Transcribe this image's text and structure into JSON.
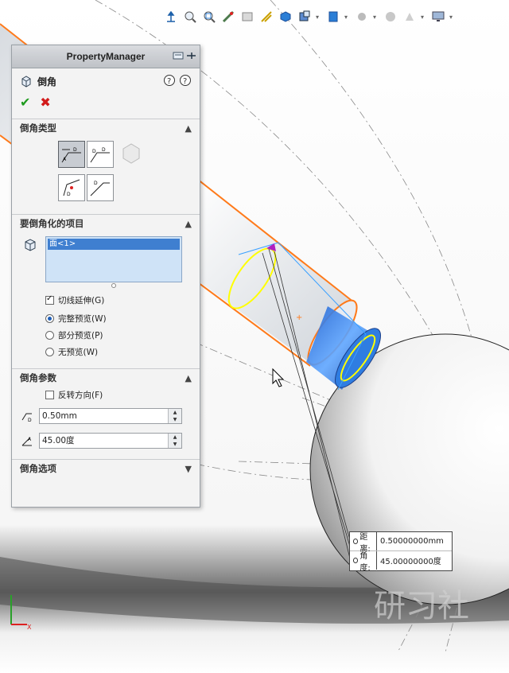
{
  "property_manager": {
    "title": "PropertyManager",
    "feature_name": "倒角",
    "sections": {
      "chamfer_type": {
        "title": "倒角类型"
      },
      "items": {
        "title": "要倒角化的项目",
        "list": [
          "面<1>"
        ],
        "options": {
          "tangent_propagation": {
            "label": "切线延伸(G)",
            "checked": true
          },
          "preview_radios": [
            {
              "label": "完整预览(W)",
              "checked": true
            },
            {
              "label": "部分预览(P)",
              "checked": false
            },
            {
              "label": "无预览(W)",
              "checked": false
            }
          ]
        }
      },
      "parameters": {
        "title": "倒角参数",
        "reverse": {
          "label": "反转方向(F)",
          "checked": false
        },
        "distance": "0.50mm",
        "angle": "45.00度"
      },
      "options": {
        "title": "倒角选项"
      }
    }
  },
  "callout": {
    "distance_label": "距离:",
    "distance_value": "0.50000000mm",
    "angle_label": "角度:",
    "angle_value": "45.00000000度"
  },
  "triad": {
    "x_label": "X"
  },
  "watermark": "研习社",
  "colors": {
    "accent_blue": "#3f7fd0",
    "preview_yellow": "#ffff00",
    "edge_orange": "#ff7a1a",
    "face_blue": "#2f7de1"
  },
  "toolbar_icons": [
    "view-orient-icon",
    "zoom-to-fit-icon",
    "zoom-area-icon",
    "previous-view-icon",
    "section-view-icon",
    "dynamic-annotation-icon",
    "view-cube-icon",
    "display-style-icon",
    "hide-show-icon",
    "edit-appearance-icon",
    "apply-scene-icon",
    "view-settings-icon",
    "monitor-icon"
  ]
}
